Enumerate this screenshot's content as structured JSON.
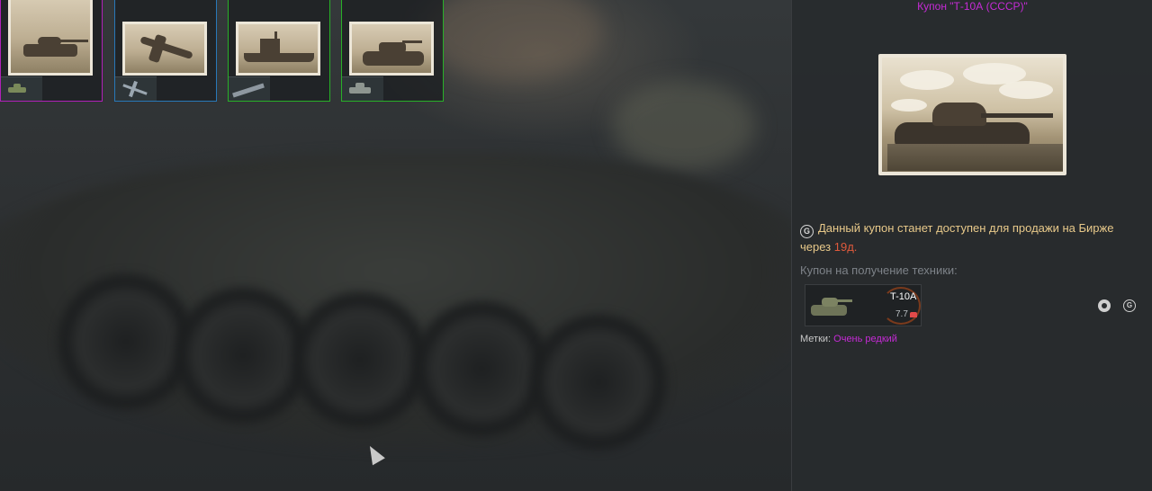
{
  "coupons": [
    {
      "icon": "tank-coupon-icon",
      "border_color": "#b020b8",
      "selected": true
    },
    {
      "icon": "aircraft-coupon-icon",
      "border_color": "#2878b8",
      "selected": false
    },
    {
      "icon": "ship-coupon-icon",
      "border_color": "#28b028",
      "selected": false
    },
    {
      "icon": "tank-coupon-icon",
      "border_color": "#28b028",
      "selected": false
    }
  ],
  "details": {
    "title": "Купон \"Т-10А (СССР)\"",
    "market_notice_prefix": "Данный купон станет доступен для продажи на Бирже через ",
    "market_notice_days": "19д.",
    "market_notice_suffix": "",
    "coupon_for_label": "Купон на получение техники:",
    "vehicle": {
      "name": "T-10A",
      "rank": "7.7",
      "nation_icon": "ussr-flag-icon"
    },
    "tags_label": "Метки: ",
    "tags_value": "Очень редкий"
  },
  "colors": {
    "rarity": "#c62bd6",
    "notice": "#e8c98a",
    "days": "#e05a3c"
  }
}
